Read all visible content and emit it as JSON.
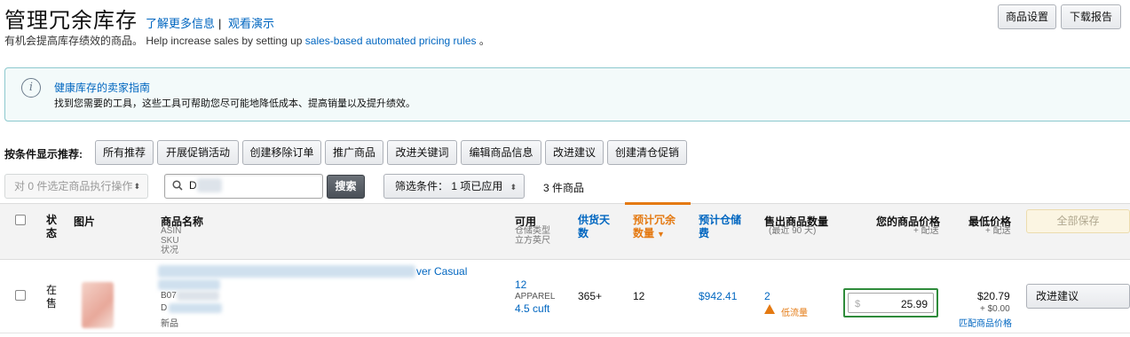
{
  "header": {
    "title": "管理冗余库存",
    "learn_more": "了解更多信息",
    "separator": "|",
    "watch_demo": "观看演示",
    "subtitle_prefix": "有机会提高库存绩效的商品。 Help increase sales by setting up ",
    "subtitle_link": "sales-based automated pricing rules",
    "subtitle_suffix": " 。",
    "product_settings_button": "商品设置",
    "download_report_button": "下载报告"
  },
  "info": {
    "icon": "info-icon",
    "title": "健康库存的卖家指南",
    "text": "找到您需要的工具，这些工具可帮助您尽可能地降低成本、提高销量以及提升绩效。"
  },
  "recommend": {
    "label": "按条件显示推荐:",
    "buttons": [
      "所有推荐",
      "开展促销活动",
      "创建移除订单",
      "推广商品",
      "改进关键词",
      "编辑商品信息",
      "改进建议",
      "创建清仓促销"
    ]
  },
  "actions": {
    "bulk_action": "对 0 件选定商品执行操作",
    "search_value": "D",
    "search_button": "搜索",
    "filter": "筛选条件： 1 项已应用",
    "item_count": "3 件商品"
  },
  "table": {
    "headers": {
      "status": "状态",
      "image": "图片",
      "product_name": "商品名称",
      "product_sub": [
        "ASIN",
        "SKU",
        "状况"
      ],
      "available": "可用",
      "available_sub": [
        "仓储类型",
        "立方英尺"
      ],
      "days_supply": "供货天数",
      "excess_qty": "预计冗余数量",
      "sort_arrow": "▼",
      "storage_fee": "预计仓储费",
      "units_sold": "售出商品数量",
      "units_sold_sub": "(最近 90 天)",
      "your_price": "您的商品价格",
      "your_price_sub": "+ 配送",
      "lowest_price": "最低价格",
      "lowest_price_sub": "+ 配送",
      "save_all": "全部保存"
    },
    "rows": [
      {
        "status": "在售",
        "title_visible": "ver Casual",
        "asin_prefix": "B07",
        "sku_prefix": "D",
        "condition": "新品",
        "available": "12",
        "storage_type": "APPAREL",
        "cubic_feet": "4.5 cuft",
        "days_supply": "365+",
        "excess_qty": "12",
        "storage_fee": "$942.41",
        "units_sold": "2",
        "low_traffic": "低流量",
        "currency": "$",
        "price": "25.99",
        "lowest_price": "$20.79",
        "lowest_shipping": "+ $0.00",
        "match_price": "匹配商品价格",
        "improve": "改进建议"
      }
    ]
  },
  "colors": {
    "link": "#0066c0",
    "accent_orange": "#e47911",
    "price_border": "#2e8b3a",
    "info_bg": "#f3fafa"
  }
}
